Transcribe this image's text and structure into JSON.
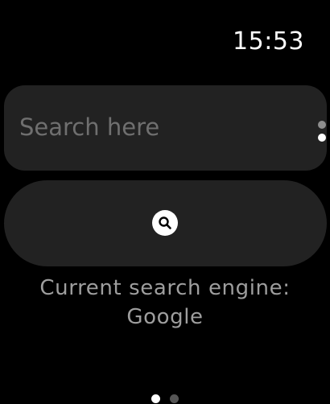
{
  "status_bar": {
    "time": "15:53"
  },
  "search": {
    "placeholder": "Search here",
    "value": ""
  },
  "search_button": {
    "icon": "search-icon"
  },
  "engine_info": {
    "line1": "Current search engine:",
    "line2": "Google"
  },
  "pagination": {
    "current_page": 1,
    "total_pages": 2
  },
  "colors": {
    "background": "#000000",
    "control_bg": "#222222",
    "placeholder_text": "#6f6f6f",
    "label_text": "#9e9e9e",
    "accent": "#ffffff"
  }
}
